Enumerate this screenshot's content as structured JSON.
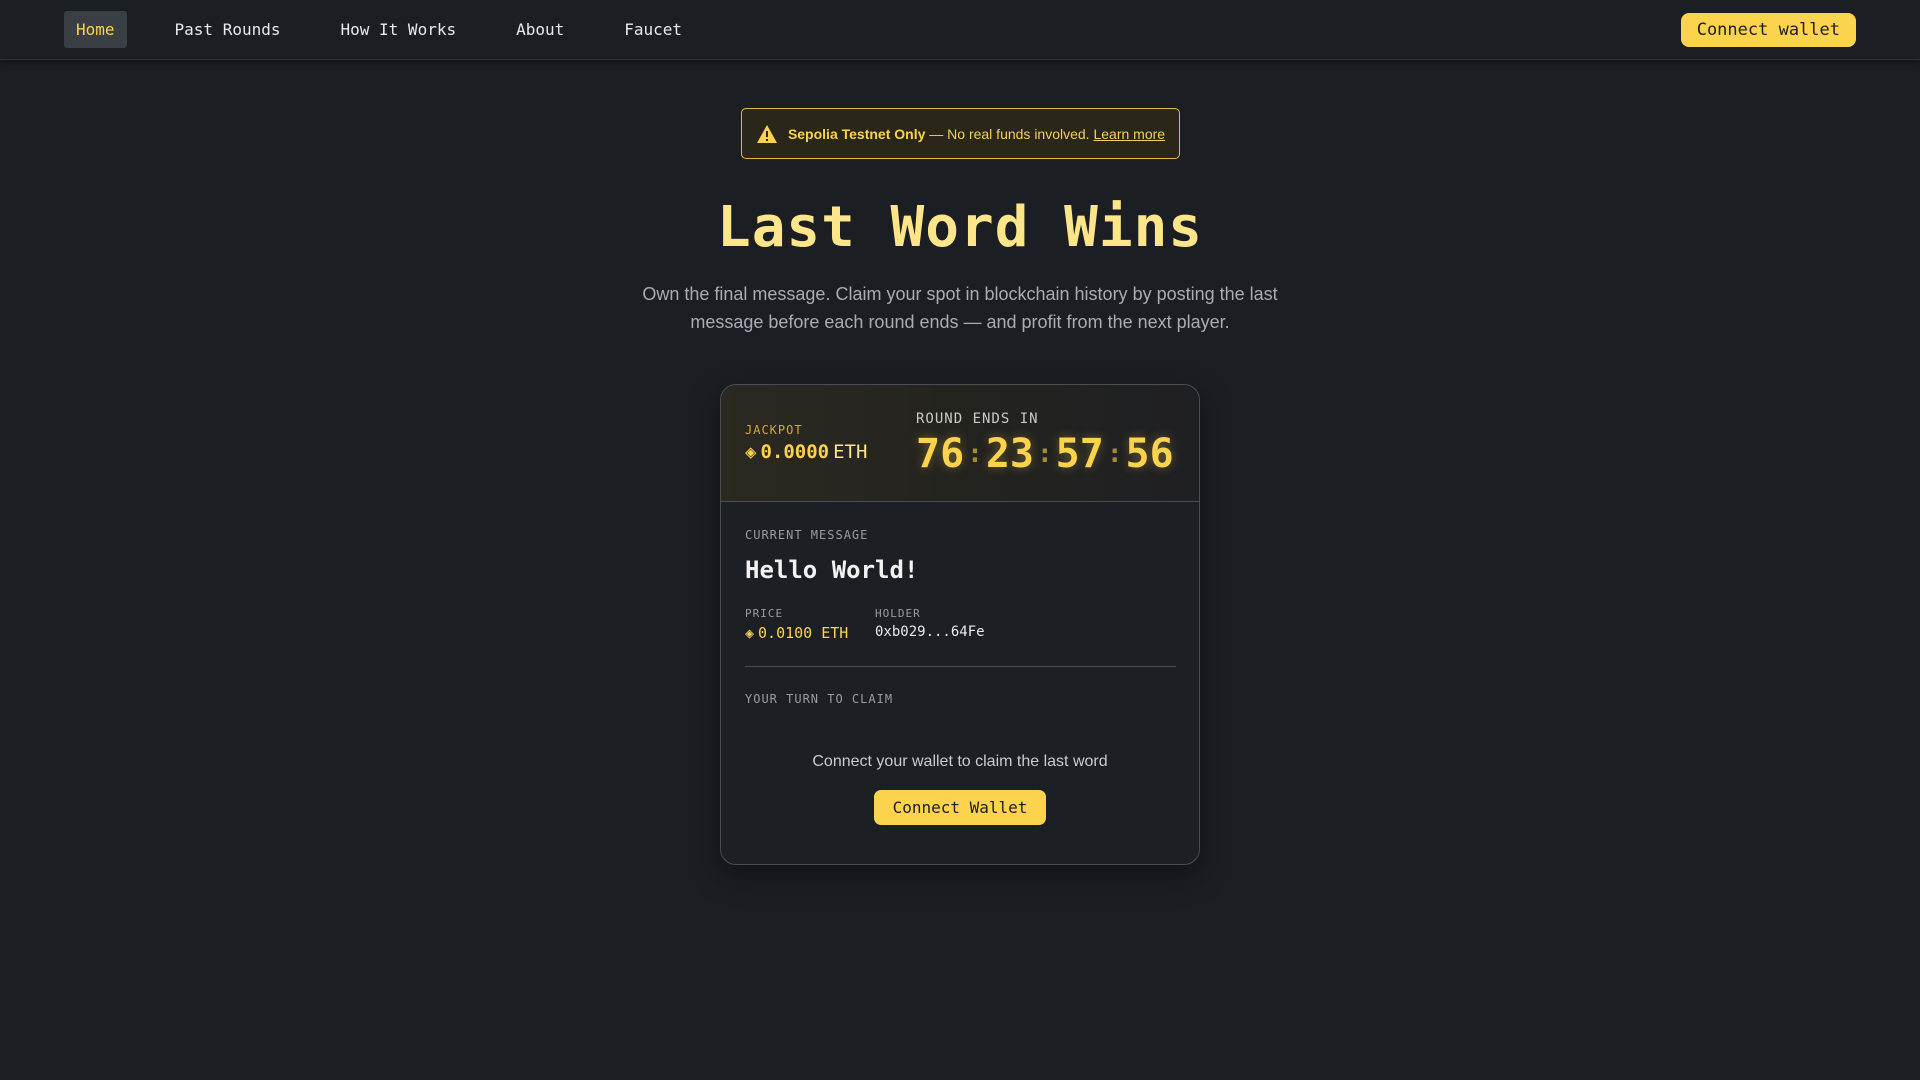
{
  "nav": {
    "links": [
      {
        "label": "Home",
        "active": true
      },
      {
        "label": "Past Rounds",
        "active": false
      },
      {
        "label": "How It Works",
        "active": false
      },
      {
        "label": "About",
        "active": false
      },
      {
        "label": "Faucet",
        "active": false
      }
    ],
    "connect_label": "Connect wallet"
  },
  "banner": {
    "icon": "warning-triangle-icon",
    "strong": "Sepolia Testnet Only",
    "text": " — No real funds involved. ",
    "link": "Learn more"
  },
  "hero": {
    "title": "Last Word Wins",
    "subtitle": "Own the final message. Claim your spot in blockchain history by posting the last message before each round ends — and profit from the next player."
  },
  "card": {
    "jackpot_label": "JACKPOT",
    "jackpot_value": "0.0000",
    "jackpot_unit": "ETH",
    "countdown_label": "ROUND ENDS IN",
    "countdown": [
      "76",
      "23",
      "57",
      "56"
    ],
    "countdown_sep": ":",
    "current_label": "CURRENT MESSAGE",
    "current_message": "Hello World!",
    "price_label": "PRICE",
    "price_value": "0.0100 ETH",
    "holder_label": "HOLDER",
    "holder_value": "0xb029...64Fe",
    "claim_label": "YOUR TURN TO CLAIM",
    "claim_prompt": "Connect your wallet to claim the last word",
    "claim_button": "Connect Wallet"
  },
  "colors": {
    "background": "#1b1e23",
    "accent": "#fcd34d",
    "title": "#fde68a"
  }
}
